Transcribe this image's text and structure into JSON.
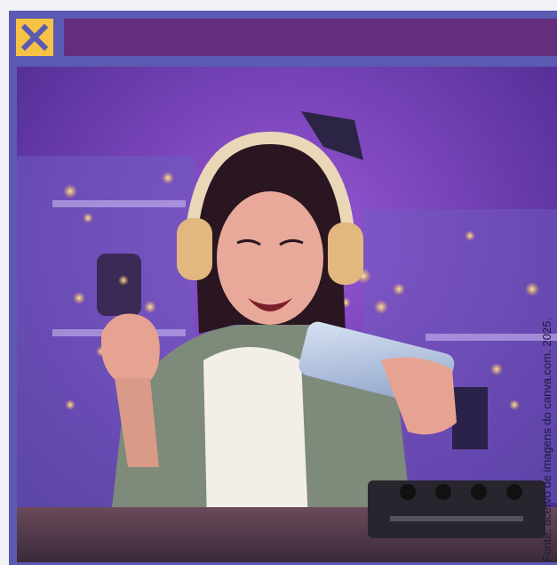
{
  "window": {
    "close_icon": "close-x-icon",
    "title": ""
  },
  "photo": {
    "description_icon": "photo-gamer-girl",
    "caption": "Fonte: acervo de imagens do canva.com. 2025."
  },
  "colors": {
    "frame": "#5b5ab2",
    "close_button": "#f6c245",
    "title_bar": "#642e7d",
    "background": "#f2f2f6"
  }
}
